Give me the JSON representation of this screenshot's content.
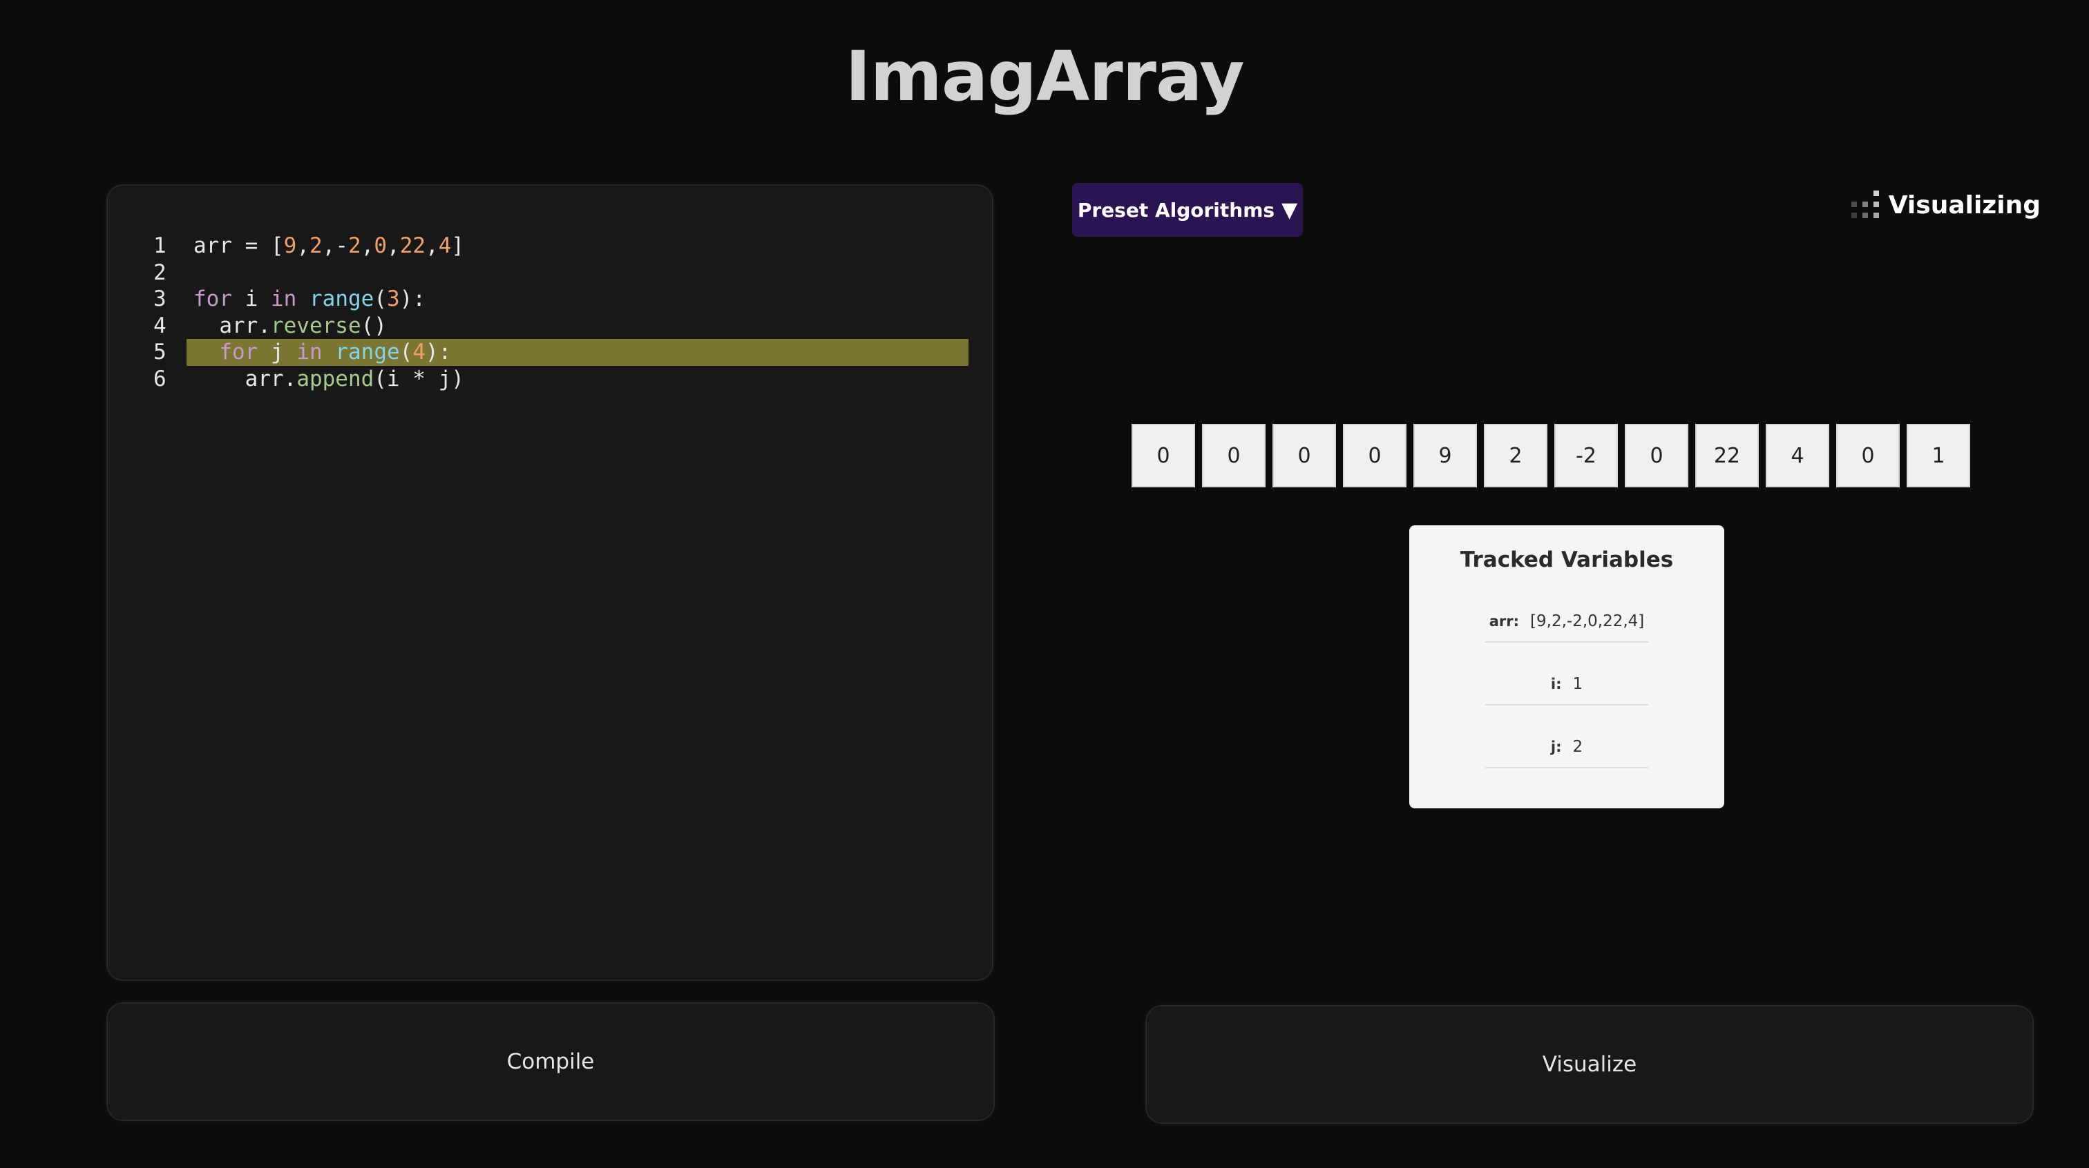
{
  "app": {
    "title": "ImagArray"
  },
  "editor": {
    "lines": [
      {
        "num": "1",
        "tokens": [
          [
            "t",
            "arr = ["
          ],
          [
            "n",
            "9"
          ],
          [
            "t",
            ","
          ],
          [
            "n",
            "2"
          ],
          [
            "t",
            ",-"
          ],
          [
            "n",
            "2"
          ],
          [
            "t",
            ","
          ],
          [
            "n",
            "0"
          ],
          [
            "t",
            ","
          ],
          [
            "n",
            "22"
          ],
          [
            "t",
            ","
          ],
          [
            "n",
            "4"
          ],
          [
            "t",
            "]"
          ]
        ]
      },
      {
        "num": "2",
        "tokens": []
      },
      {
        "num": "3",
        "tokens": [
          [
            "k",
            "for"
          ],
          [
            "t",
            " i "
          ],
          [
            "k",
            "in"
          ],
          [
            "t",
            " "
          ],
          [
            "f",
            "range"
          ],
          [
            "t",
            "("
          ],
          [
            "n",
            "3"
          ],
          [
            "t",
            "):"
          ]
        ]
      },
      {
        "num": "4",
        "tokens": [
          [
            "t",
            "  arr."
          ],
          [
            "m",
            "reverse"
          ],
          [
            "t",
            "()"
          ]
        ]
      },
      {
        "num": "5",
        "highlighted": true,
        "tokens": [
          [
            "t",
            "  "
          ],
          [
            "k",
            "for"
          ],
          [
            "t",
            " j "
          ],
          [
            "k",
            "in"
          ],
          [
            "t",
            " "
          ],
          [
            "f",
            "range"
          ],
          [
            "t",
            "("
          ],
          [
            "n",
            "4"
          ],
          [
            "t",
            "):"
          ]
        ]
      },
      {
        "num": "6",
        "tokens": [
          [
            "t",
            "    arr."
          ],
          [
            "m",
            "append"
          ],
          [
            "t",
            "(i * j)"
          ]
        ]
      }
    ]
  },
  "buttons": {
    "compile": "Compile",
    "visualize": "Visualize"
  },
  "preset": {
    "label": "Preset Algorithms",
    "arrow": "▼"
  },
  "status": {
    "label": "Visualizing",
    "icon": "loading-spinner-icon"
  },
  "array": [
    "0",
    "0",
    "0",
    "0",
    "9",
    "2",
    "-2",
    "0",
    "22",
    "4",
    "0",
    "1"
  ],
  "tracked": {
    "title": "Tracked Variables",
    "variables": [
      {
        "name": "arr:",
        "value": "[9,2,-2,0,22,4]"
      },
      {
        "name": "i:",
        "value": "1"
      },
      {
        "name": "j:",
        "value": "2"
      }
    ]
  },
  "colors": {
    "highlight": "#7b7534",
    "keyword": "#c79ac9",
    "function": "#87d3e6",
    "method": "#a9c992",
    "number": "#f0a06a",
    "preset_bg": "#2a1452"
  }
}
